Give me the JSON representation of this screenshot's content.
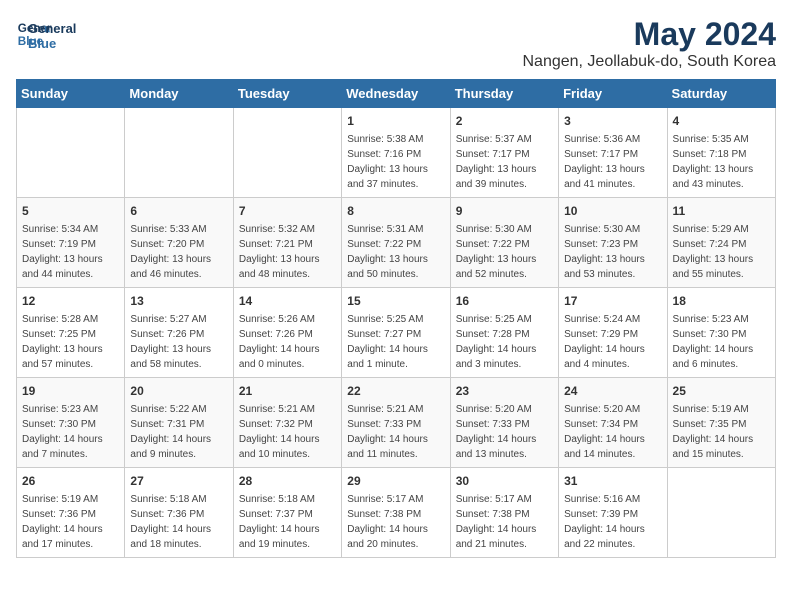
{
  "header": {
    "logo_line1": "General",
    "logo_line2": "Blue",
    "month": "May 2024",
    "location": "Nangen, Jeollabuk-do, South Korea"
  },
  "calendar": {
    "days_of_week": [
      "Sunday",
      "Monday",
      "Tuesday",
      "Wednesday",
      "Thursday",
      "Friday",
      "Saturday"
    ],
    "weeks": [
      [
        {
          "day": "",
          "info": ""
        },
        {
          "day": "",
          "info": ""
        },
        {
          "day": "",
          "info": ""
        },
        {
          "day": "1",
          "info": "Sunrise: 5:38 AM\nSunset: 7:16 PM\nDaylight: 13 hours\nand 37 minutes."
        },
        {
          "day": "2",
          "info": "Sunrise: 5:37 AM\nSunset: 7:17 PM\nDaylight: 13 hours\nand 39 minutes."
        },
        {
          "day": "3",
          "info": "Sunrise: 5:36 AM\nSunset: 7:17 PM\nDaylight: 13 hours\nand 41 minutes."
        },
        {
          "day": "4",
          "info": "Sunrise: 5:35 AM\nSunset: 7:18 PM\nDaylight: 13 hours\nand 43 minutes."
        }
      ],
      [
        {
          "day": "5",
          "info": "Sunrise: 5:34 AM\nSunset: 7:19 PM\nDaylight: 13 hours\nand 44 minutes."
        },
        {
          "day": "6",
          "info": "Sunrise: 5:33 AM\nSunset: 7:20 PM\nDaylight: 13 hours\nand 46 minutes."
        },
        {
          "day": "7",
          "info": "Sunrise: 5:32 AM\nSunset: 7:21 PM\nDaylight: 13 hours\nand 48 minutes."
        },
        {
          "day": "8",
          "info": "Sunrise: 5:31 AM\nSunset: 7:22 PM\nDaylight: 13 hours\nand 50 minutes."
        },
        {
          "day": "9",
          "info": "Sunrise: 5:30 AM\nSunset: 7:22 PM\nDaylight: 13 hours\nand 52 minutes."
        },
        {
          "day": "10",
          "info": "Sunrise: 5:30 AM\nSunset: 7:23 PM\nDaylight: 13 hours\nand 53 minutes."
        },
        {
          "day": "11",
          "info": "Sunrise: 5:29 AM\nSunset: 7:24 PM\nDaylight: 13 hours\nand 55 minutes."
        }
      ],
      [
        {
          "day": "12",
          "info": "Sunrise: 5:28 AM\nSunset: 7:25 PM\nDaylight: 13 hours\nand 57 minutes."
        },
        {
          "day": "13",
          "info": "Sunrise: 5:27 AM\nSunset: 7:26 PM\nDaylight: 13 hours\nand 58 minutes."
        },
        {
          "day": "14",
          "info": "Sunrise: 5:26 AM\nSunset: 7:26 PM\nDaylight: 14 hours\nand 0 minutes."
        },
        {
          "day": "15",
          "info": "Sunrise: 5:25 AM\nSunset: 7:27 PM\nDaylight: 14 hours\nand 1 minute."
        },
        {
          "day": "16",
          "info": "Sunrise: 5:25 AM\nSunset: 7:28 PM\nDaylight: 14 hours\nand 3 minutes."
        },
        {
          "day": "17",
          "info": "Sunrise: 5:24 AM\nSunset: 7:29 PM\nDaylight: 14 hours\nand 4 minutes."
        },
        {
          "day": "18",
          "info": "Sunrise: 5:23 AM\nSunset: 7:30 PM\nDaylight: 14 hours\nand 6 minutes."
        }
      ],
      [
        {
          "day": "19",
          "info": "Sunrise: 5:23 AM\nSunset: 7:30 PM\nDaylight: 14 hours\nand 7 minutes."
        },
        {
          "day": "20",
          "info": "Sunrise: 5:22 AM\nSunset: 7:31 PM\nDaylight: 14 hours\nand 9 minutes."
        },
        {
          "day": "21",
          "info": "Sunrise: 5:21 AM\nSunset: 7:32 PM\nDaylight: 14 hours\nand 10 minutes."
        },
        {
          "day": "22",
          "info": "Sunrise: 5:21 AM\nSunset: 7:33 PM\nDaylight: 14 hours\nand 11 minutes."
        },
        {
          "day": "23",
          "info": "Sunrise: 5:20 AM\nSunset: 7:33 PM\nDaylight: 14 hours\nand 13 minutes."
        },
        {
          "day": "24",
          "info": "Sunrise: 5:20 AM\nSunset: 7:34 PM\nDaylight: 14 hours\nand 14 minutes."
        },
        {
          "day": "25",
          "info": "Sunrise: 5:19 AM\nSunset: 7:35 PM\nDaylight: 14 hours\nand 15 minutes."
        }
      ],
      [
        {
          "day": "26",
          "info": "Sunrise: 5:19 AM\nSunset: 7:36 PM\nDaylight: 14 hours\nand 17 minutes."
        },
        {
          "day": "27",
          "info": "Sunrise: 5:18 AM\nSunset: 7:36 PM\nDaylight: 14 hours\nand 18 minutes."
        },
        {
          "day": "28",
          "info": "Sunrise: 5:18 AM\nSunset: 7:37 PM\nDaylight: 14 hours\nand 19 minutes."
        },
        {
          "day": "29",
          "info": "Sunrise: 5:17 AM\nSunset: 7:38 PM\nDaylight: 14 hours\nand 20 minutes."
        },
        {
          "day": "30",
          "info": "Sunrise: 5:17 AM\nSunset: 7:38 PM\nDaylight: 14 hours\nand 21 minutes."
        },
        {
          "day": "31",
          "info": "Sunrise: 5:16 AM\nSunset: 7:39 PM\nDaylight: 14 hours\nand 22 minutes."
        },
        {
          "day": "",
          "info": ""
        }
      ]
    ]
  }
}
